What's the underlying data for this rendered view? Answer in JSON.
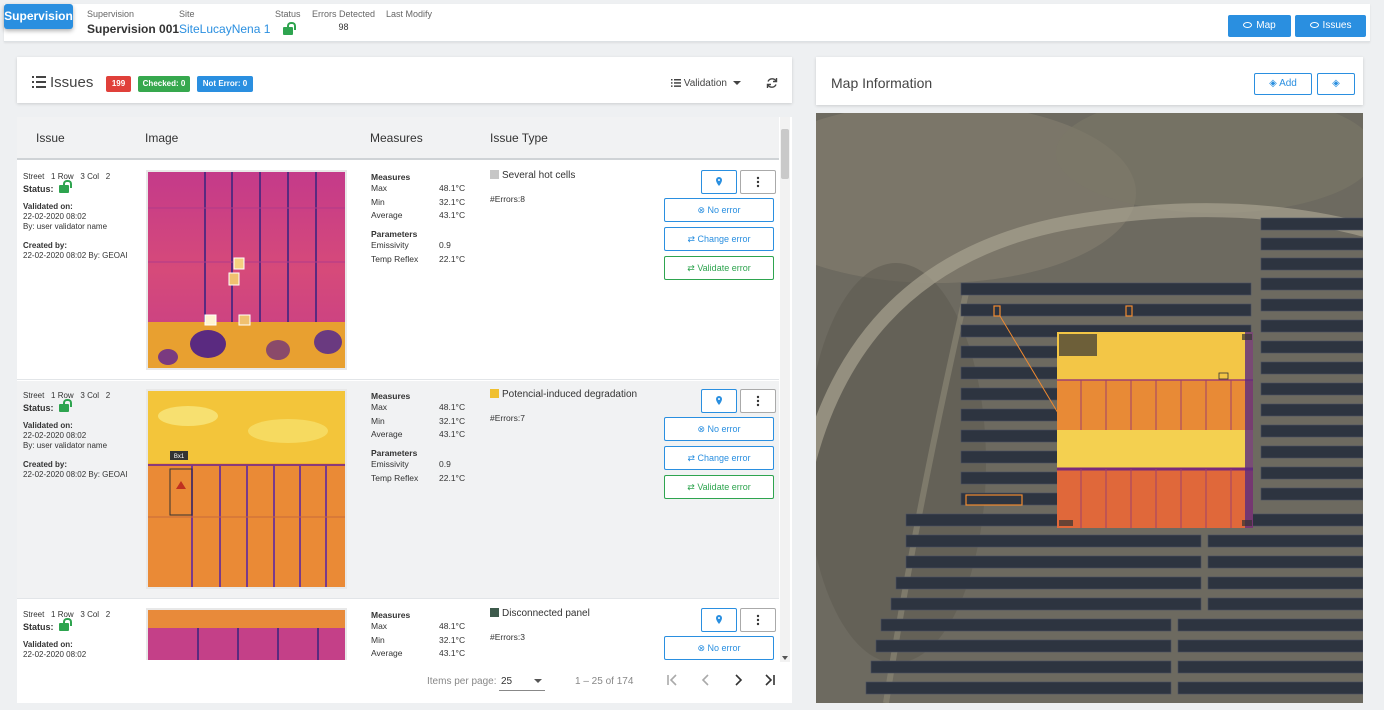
{
  "header": {
    "brand": "Supervision",
    "supervision_label": "Supervision",
    "supervision_value": "Supervision 001",
    "site_label": "Site",
    "site_value": "SiteLucayNena 1",
    "status_label": "Status",
    "errors_label": "Errors Detected",
    "errors_value": "98",
    "modify_label": "Last Modify",
    "map_button": "Map",
    "issues_button": "Issues"
  },
  "issues_panel": {
    "title": "Issues",
    "badge_total": "199",
    "badge_checked": "Checked: 0",
    "badge_not_error": "Not Error: 0",
    "validation_dropdown": "Validation"
  },
  "table": {
    "columns": [
      "Issue",
      "Image",
      "Measures",
      "Issue Type"
    ],
    "rows": [
      {
        "street_label": "Street",
        "street": "1",
        "row_label": "Row",
        "row": "3",
        "col_label": "Col",
        "col": "2",
        "status_label": "Status:",
        "validated_label": "Validated on:",
        "validated_date": "22-02-2020 08:02",
        "validated_by": "By: user validator name",
        "created_label": "Created by:",
        "created_info": "22-02-2020 08:02 By: GEOAI",
        "measures_label": "Measures",
        "max_label": "Max",
        "max": "48.1°C",
        "min_label": "Min",
        "min": "32.1°C",
        "avg_label": "Average",
        "avg": "43.1°C",
        "params_label": "Parameters",
        "emis_label": "Emissivity",
        "emis": "0.9",
        "temp_label": "Temp Reflex",
        "temp": "22.1°C",
        "issue_type": "Several hot cells",
        "type_color": "#c6c6c6",
        "errors": "#Errors:8",
        "no_error": "No error",
        "change_error": "Change error",
        "validate_error": "Validate error"
      },
      {
        "street_label": "Street",
        "street": "1",
        "row_label": "Row",
        "row": "3",
        "col_label": "Col",
        "col": "2",
        "status_label": "Status:",
        "validated_label": "Validated on:",
        "validated_date": "22-02-2020 08:02",
        "validated_by": "By: user validator name",
        "created_label": "Created by:",
        "created_info": "22-02-2020 08:02 By: GEOAI",
        "measures_label": "Measures",
        "max_label": "Max",
        "max": "48.1°C",
        "min_label": "Min",
        "min": "32.1°C",
        "avg_label": "Average",
        "avg": "43.1°C",
        "params_label": "Parameters",
        "emis_label": "Emissivity",
        "emis": "0.9",
        "temp_label": "Temp Reflex",
        "temp": "22.1°C",
        "issue_type": "Potencial-induced degradation",
        "type_color": "#f0c030",
        "errors": "#Errors:7",
        "box_label": "Bx1",
        "no_error": "No error",
        "change_error": "Change error",
        "validate_error": "Validate error"
      },
      {
        "street_label": "Street",
        "street": "1",
        "row_label": "Row",
        "row": "3",
        "col_label": "Col",
        "col": "2",
        "status_label": "Status:",
        "validated_label": "Validated on:",
        "validated_date": "22-02-2020 08:02",
        "measures_label": "Measures",
        "max_label": "Max",
        "max": "48.1°C",
        "min_label": "Min",
        "min": "32.1°C",
        "avg_label": "Average",
        "avg": "43.1°C",
        "issue_type": "Disconnected panel",
        "type_color": "#3d5a4c",
        "errors": "#Errors:3",
        "no_error": "No error"
      }
    ]
  },
  "pagination": {
    "items_per_page_label": "Items per page:",
    "items_per_page": "25",
    "range": "1 – 25 of 174"
  },
  "map_panel": {
    "title": "Map Information",
    "add_button": "Add"
  }
}
